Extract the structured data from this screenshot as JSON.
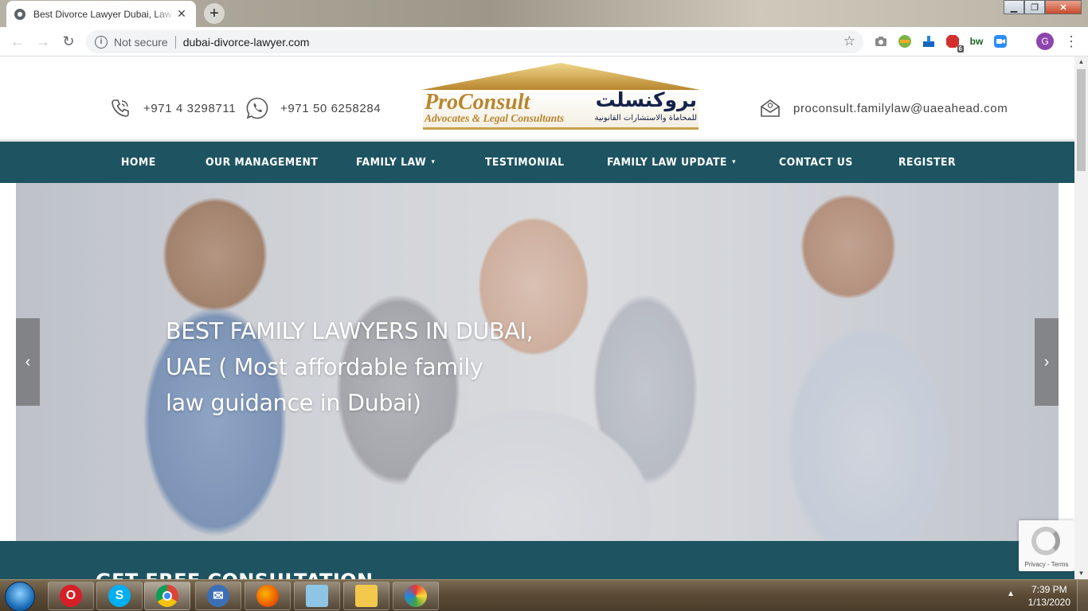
{
  "browser": {
    "tab_title": "Best Divorce Lawyer Dubai, Law F",
    "security_label": "Not secure",
    "url": "dubai-divorce-lawyer.com",
    "profile_initial": "G",
    "abp_badge": "6",
    "ext_bw_label": "bw"
  },
  "header": {
    "phone": "+971 4 3298711",
    "whatsapp": "+971 50 6258284",
    "email": "proconsult.familylaw@uaeahead.com",
    "logo": {
      "name_en": "ProConsult",
      "tagline_en": "Advocates & Legal Consultants",
      "name_ar": "بروكنسلت",
      "tagline_ar": "للمحاماة والاستشارات القانونية"
    }
  },
  "nav": {
    "items": [
      {
        "label": "HOME"
      },
      {
        "label": "OUR MANAGEMENT"
      },
      {
        "label": "FAMILY LAW",
        "dropdown": true
      },
      {
        "label": "TESTIMONIAL"
      },
      {
        "label": "FAMILY LAW UPDATE",
        "dropdown": true
      },
      {
        "label": "CONTACT US"
      },
      {
        "label": "REGISTER"
      }
    ]
  },
  "hero": {
    "line1": "BEST FAMILY LAWYERS IN DUBAI,",
    "line2": "UAE ( Most affordable family",
    "line3": "law guidance in Dubai)"
  },
  "band": {
    "heading": "GET FREE CONSULTATION"
  },
  "recaptcha": {
    "links": "Privacy - Terms"
  },
  "taskbar": {
    "time": "7:39 PM",
    "date": "1/13/2020"
  },
  "colors": {
    "brand_teal": "#1e5461",
    "logo_gold": "#b8862e",
    "logo_navy": "#14224a"
  }
}
